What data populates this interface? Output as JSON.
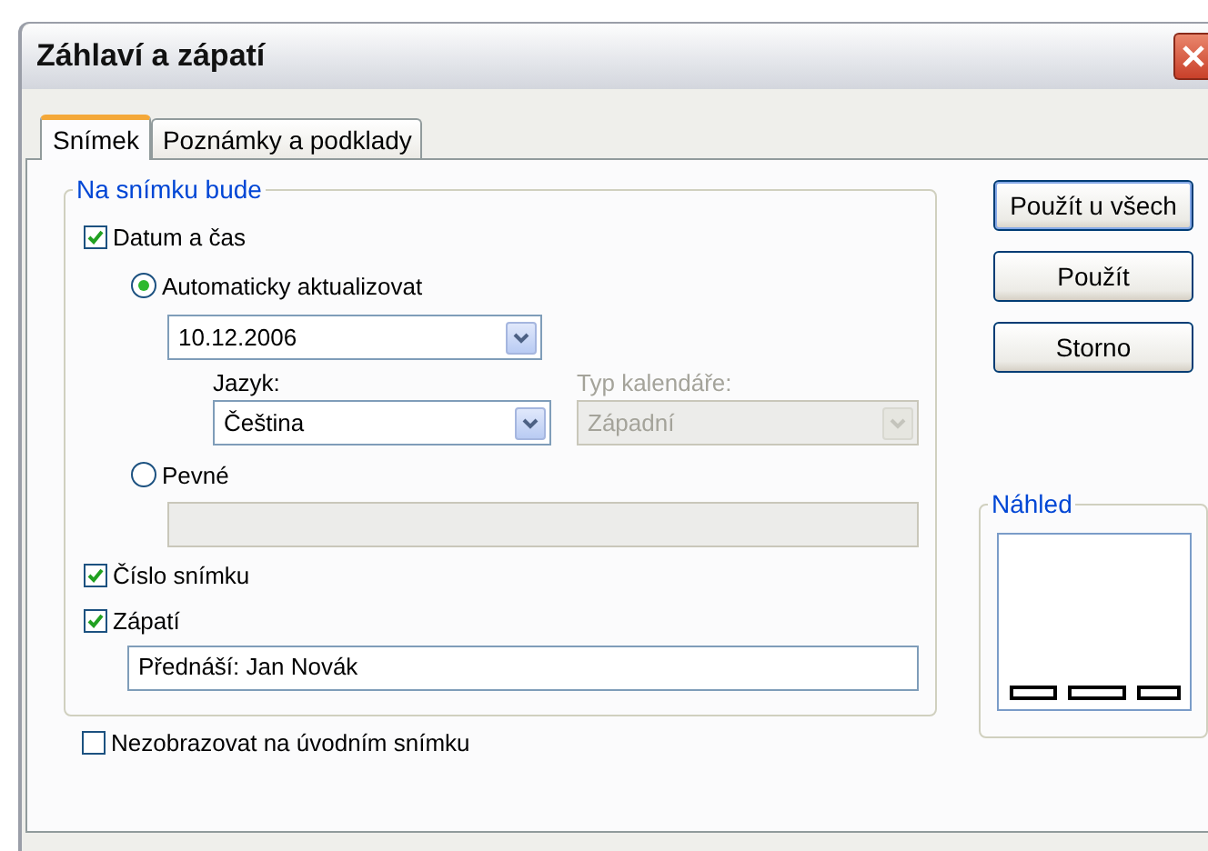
{
  "window": {
    "title": "Záhlaví a zápatí"
  },
  "tabs": [
    {
      "label": "Snímek",
      "selected": true
    },
    {
      "label": "Poznámky a podklady",
      "selected": false
    }
  ],
  "group": {
    "legend": "Na snímku bude",
    "date_time": {
      "label": "Datum a čas",
      "checked": true
    },
    "auto_update": {
      "label": "Automaticky aktualizovat",
      "selected": true,
      "value": "10.12.2006"
    },
    "language": {
      "label": "Jazyk:",
      "value": "Čeština",
      "disabled": false
    },
    "calendar_type": {
      "label": "Typ kalendáře:",
      "value": "Západní",
      "disabled": true
    },
    "fixed": {
      "label": "Pevné",
      "selected": false,
      "field_disabled": true
    },
    "slide_number": {
      "label": "Číslo snímku",
      "checked": true
    },
    "footer": {
      "label": "Zápatí",
      "checked": true,
      "value": "Přednáší: Jan Novák"
    }
  },
  "dont_show_on_title_slide": {
    "label": "Nezobrazovat na úvodním snímku",
    "checked": false
  },
  "buttons": [
    {
      "label": "Použít u všech",
      "default": true
    },
    {
      "label": "Použít",
      "default": false
    },
    {
      "label": "Storno",
      "default": false
    }
  ],
  "preview": {
    "legend": "Náhled"
  }
}
